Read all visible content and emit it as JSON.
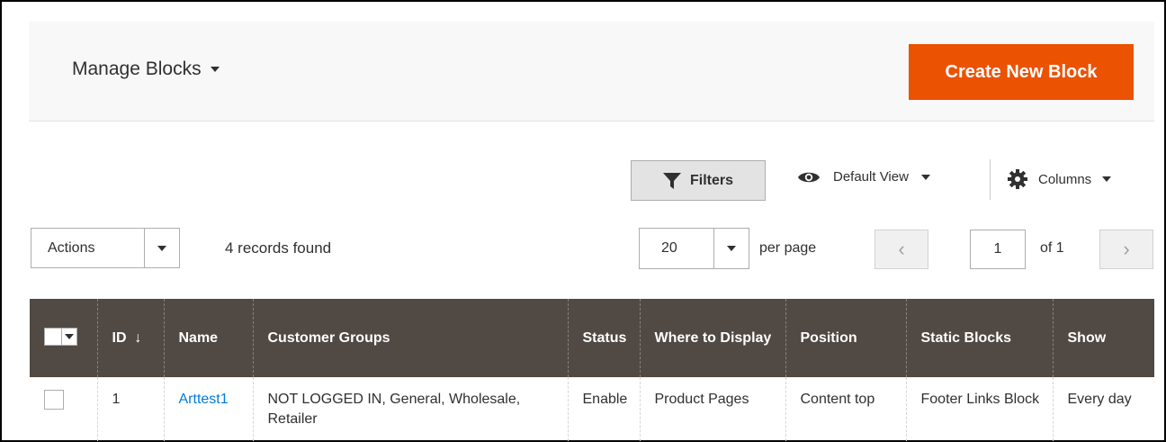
{
  "header": {
    "title": "Manage Blocks",
    "create_button": "Create New Block"
  },
  "toolbar": {
    "filters_label": "Filters",
    "view_label": "Default View",
    "columns_label": "Columns",
    "actions_label": "Actions",
    "records_found": "4 records found",
    "per_page_value": "20",
    "per_page_label": "per page",
    "page_number": "1",
    "page_of": "of 1",
    "prev_glyph": "‹",
    "next_glyph": "›"
  },
  "grid": {
    "columns": [
      "ID",
      "Name",
      "Customer Groups",
      "Status",
      "Where to Display",
      "Position",
      "Static Blocks",
      "Show"
    ],
    "sort_indicator": "↓",
    "rows": [
      {
        "id": "1",
        "name": "Arttest1",
        "customer_groups": "NOT LOGGED IN, General, Wholesale, Retailer",
        "status": "Enable",
        "where_to_display": "Product Pages",
        "position": "Content top",
        "static_blocks": "Footer Links Block",
        "show": "Every day"
      }
    ]
  },
  "colors": {
    "accent": "#eb5202",
    "grid_header": "#514943",
    "link": "#007bdb"
  },
  "icons": [
    "caret-down-icon",
    "filter-icon",
    "eye-icon",
    "gear-icon",
    "chevron-left-icon",
    "chevron-right-icon"
  ]
}
